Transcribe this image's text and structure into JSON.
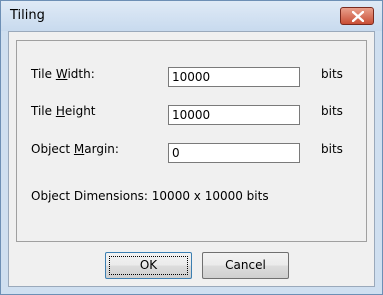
{
  "window": {
    "title": "Tiling",
    "close_icon": "close-icon"
  },
  "form": {
    "tile_width": {
      "label_pre": "Tile ",
      "label_u": "W",
      "label_post": "idth:",
      "value": "10000",
      "unit": "bits"
    },
    "tile_height": {
      "label_pre": "Tile ",
      "label_u": "H",
      "label_post": "eight",
      "value": "10000",
      "unit": "bits"
    },
    "object_margin": {
      "label_pre": "Object ",
      "label_u": "M",
      "label_post": "argin:",
      "value": "0",
      "unit": "bits"
    },
    "dimensions_text": "Object Dimensions:  10000 x 10000 bits"
  },
  "buttons": {
    "ok_label": "OK",
    "cancel_label": "Cancel"
  },
  "colors": {
    "title_bar": "#c8daee",
    "close_button": "#c94e35",
    "default_button_border": "#3c7fb1"
  }
}
